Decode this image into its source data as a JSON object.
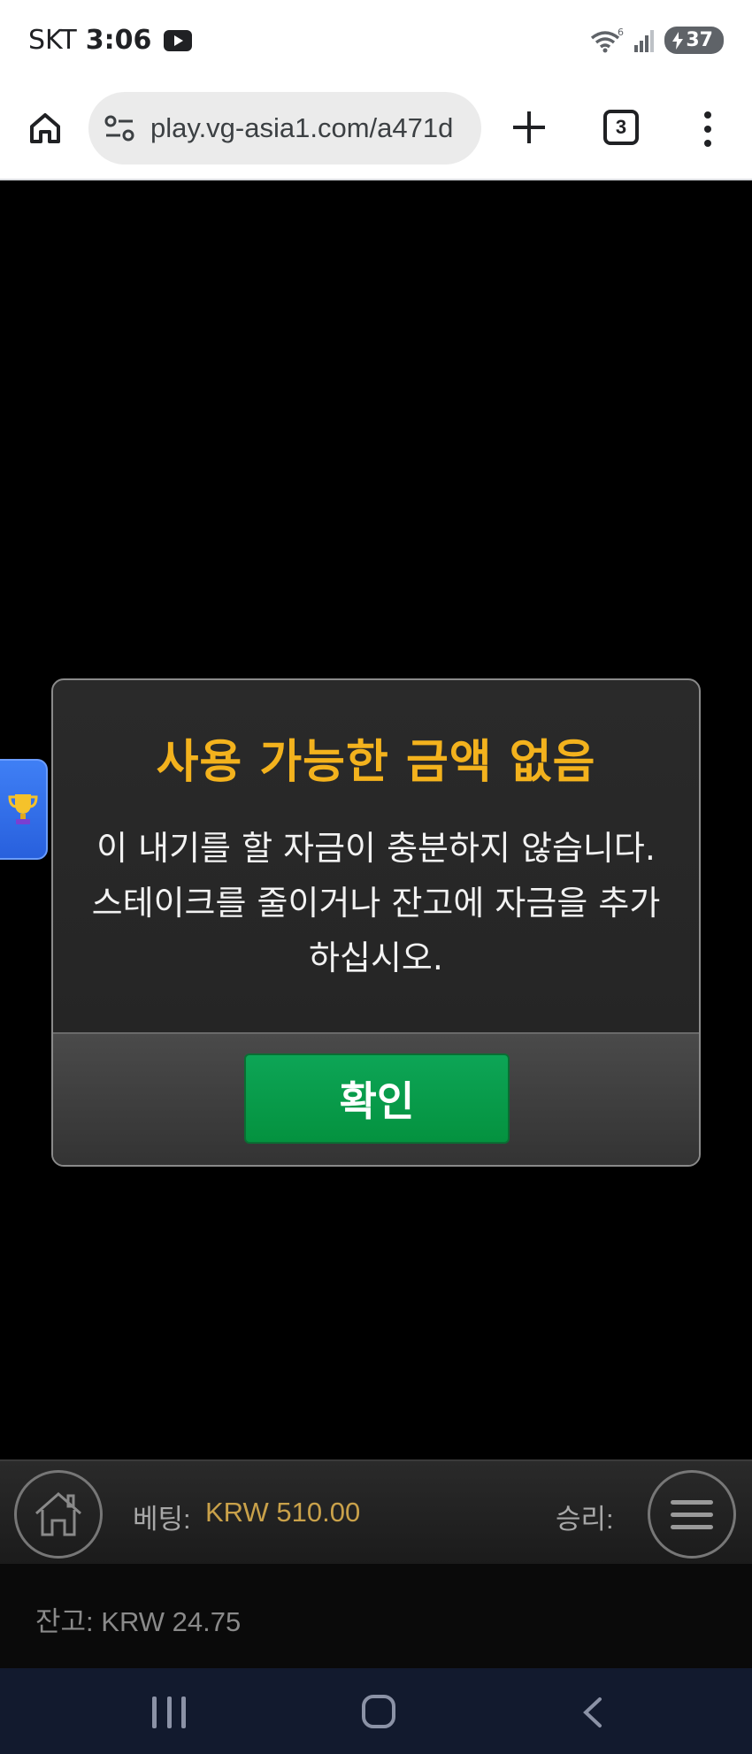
{
  "status_bar": {
    "carrier": "SKT",
    "time": "3:06",
    "battery": "37",
    "wifi_badge": "6",
    "icons": [
      "youtube-icon",
      "wifi-icon",
      "signal-icon",
      "battery-charging-icon"
    ]
  },
  "browser": {
    "url": "play.vg-asia1.com/a471d",
    "tab_count": "3",
    "icons": [
      "home-icon",
      "site-settings-icon",
      "new-tab-plus-icon",
      "tab-switcher-icon",
      "more-menu-icon"
    ]
  },
  "dialog": {
    "title": "사용 가능한 금액 없음",
    "message_line1": "이 내기를 할 자금이 충분하지 않습니다.",
    "message_line2": "스테이크를 줄이거나 잔고에 자금을 추가",
    "message_line3": "하십시오.",
    "confirm_label": "확인"
  },
  "game_bar": {
    "bet_label": "베팅:",
    "bet_value": "KRW 510.00",
    "win_label": "승리:",
    "balance": "잔고: KRW 24.75"
  },
  "colors": {
    "title": "#f3b21d",
    "confirm": "#04923f",
    "bet_value": "#c9a14a",
    "side_tab": "#2860dd"
  },
  "nav": {
    "icons": [
      "recent-apps-icon",
      "home-nav-icon",
      "back-icon"
    ]
  }
}
